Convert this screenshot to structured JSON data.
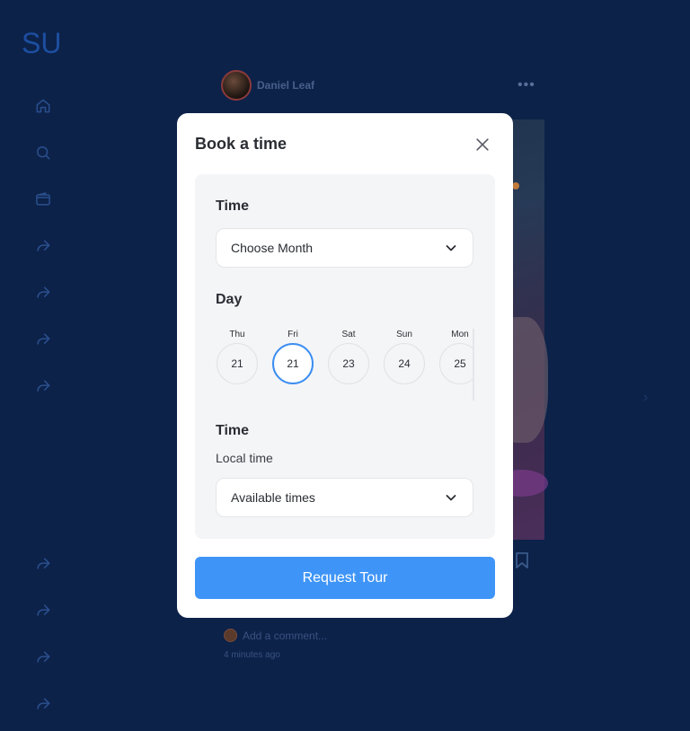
{
  "app": {
    "logo": "SU"
  },
  "sidebar": {
    "items": [
      {
        "icon": "home-icon"
      },
      {
        "icon": "search-icon"
      },
      {
        "icon": "wallet-icon"
      },
      {
        "icon": "share-icon"
      },
      {
        "icon": "share-icon"
      },
      {
        "icon": "share-icon"
      },
      {
        "icon": "share-icon"
      }
    ],
    "bottom_items": [
      {
        "icon": "share-icon"
      },
      {
        "icon": "share-icon"
      },
      {
        "icon": "share-icon"
      },
      {
        "icon": "share-icon"
      }
    ]
  },
  "post": {
    "author": "Daniel Leaf",
    "more_icon": "more-horizontal-icon",
    "comment_placeholder": "Add a comment...",
    "time_ago": "4 minutes ago"
  },
  "modal": {
    "title": "Book a time",
    "close_icon": "close-icon",
    "time_label": "Time",
    "month_select": {
      "value": "Choose Month",
      "icon": "chevron-down-icon"
    },
    "day_label": "Day",
    "days": [
      {
        "name": "Thu",
        "num": "21",
        "selected": false
      },
      {
        "name": "Fri",
        "num": "21",
        "selected": true
      },
      {
        "name": "Sat",
        "num": "23",
        "selected": false
      },
      {
        "name": "Sun",
        "num": "24",
        "selected": false
      },
      {
        "name": "Mon",
        "num": "25",
        "selected": false
      }
    ],
    "time_label_2": "Time",
    "local_time_label": "Local time",
    "times_select": {
      "value": "Available times",
      "icon": "chevron-down-icon"
    },
    "request_button": "Request Tour"
  },
  "colors": {
    "background": "#0c2249",
    "accent": "#3f95f7",
    "selected_day_border": "#3b8ef0"
  }
}
